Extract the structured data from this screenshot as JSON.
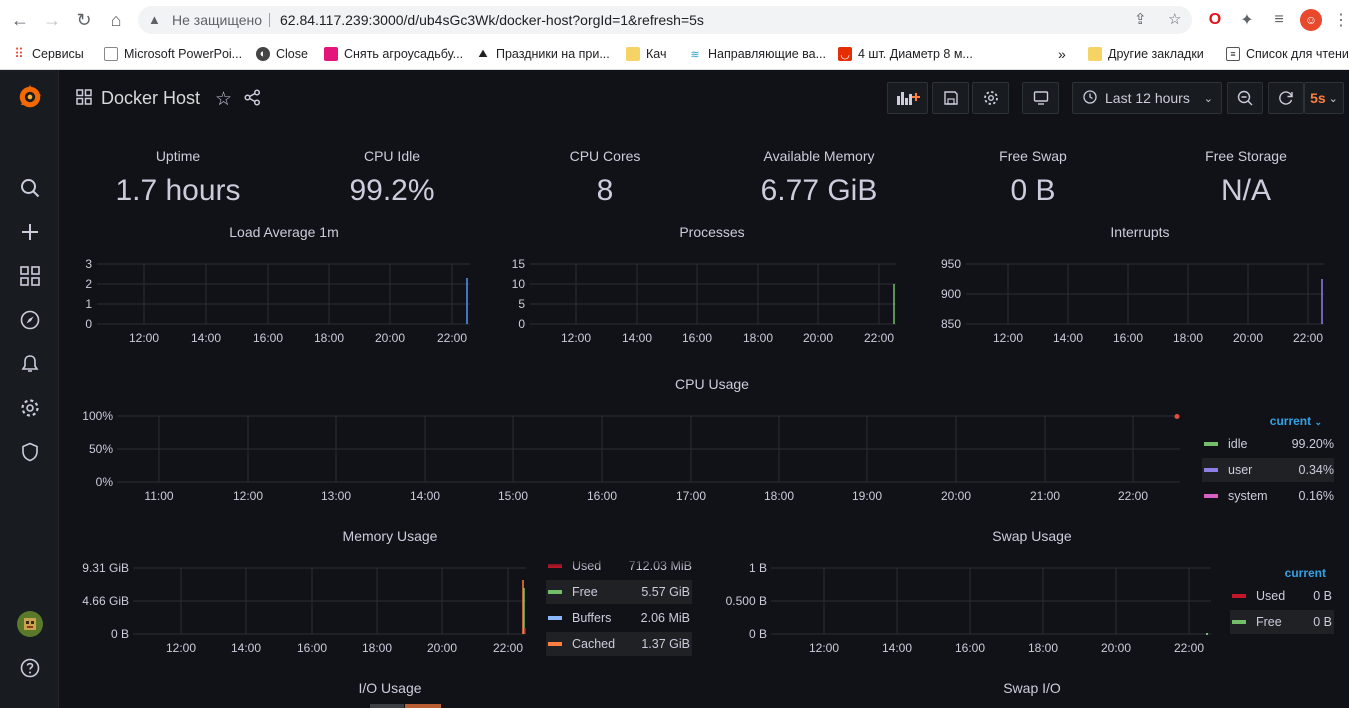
{
  "browser": {
    "address_warning": "Не защищено",
    "url": "62.84.117.239:3000/d/ub4sGc3Wk/docker-host?orgId=1&refresh=5s",
    "bookmarks": [
      {
        "label": "Сервисы",
        "icon": "apps-grid-icon"
      },
      {
        "label": "Microsoft PowerPoi...",
        "icon": "document-icon"
      },
      {
        "label": "Close",
        "icon": "globe-icon"
      },
      {
        "label": "Снять агроусадьбу...",
        "icon": "pink-site-icon"
      },
      {
        "label": "Праздники на при...",
        "icon": "mountain-icon"
      },
      {
        "label": "Кач",
        "icon": "folder-icon"
      },
      {
        "label": "Направляющие ва...",
        "icon": "wave-icon"
      },
      {
        "label": "4 шт. Диаметр 8 м...",
        "icon": "aliexpress-icon"
      }
    ],
    "more_bookmarks": "»",
    "other_bookmarks": "Другие закладки",
    "reading_list": "Список для чтения"
  },
  "dashboard": {
    "title": "Docker Host",
    "time_range": "Last 12 hours",
    "refresh": "5s"
  },
  "stats": [
    {
      "title": "Uptime",
      "value": "1.7 hours"
    },
    {
      "title": "CPU Idle",
      "value": "99.2%"
    },
    {
      "title": "CPU Cores",
      "value": "8"
    },
    {
      "title": "Available Memory",
      "value": "6.77 GiB"
    },
    {
      "title": "Free Swap",
      "value": "0 B"
    },
    {
      "title": "Free Storage",
      "value": "N/A"
    }
  ],
  "panels": {
    "load": {
      "title": "Load Average 1m"
    },
    "processes": {
      "title": "Processes"
    },
    "interrupts": {
      "title": "Interrupts"
    },
    "cpu": {
      "title": "CPU Usage",
      "legend_header": "current",
      "legend": [
        {
          "name": "idle",
          "value": "99.20%",
          "color": "#73bf69"
        },
        {
          "name": "user",
          "value": "0.34%",
          "color": "#8f7ee6"
        },
        {
          "name": "system",
          "value": "0.16%",
          "color": "#d85ec8"
        }
      ]
    },
    "memory": {
      "title": "Memory Usage",
      "legend": [
        {
          "name": "Used",
          "value": "712.03 MiB",
          "color": "#c4162a"
        },
        {
          "name": "Free",
          "value": "5.57 GiB",
          "color": "#73bf69"
        },
        {
          "name": "Buffers",
          "value": "2.06 MiB",
          "color": "#8ab8ff"
        },
        {
          "name": "Cached",
          "value": "1.37 GiB",
          "color": "#ff7f3f"
        }
      ]
    },
    "swap": {
      "title": "Swap Usage",
      "legend_header": "current",
      "legend": [
        {
          "name": "Used",
          "value": "0 B",
          "color": "#c4162a"
        },
        {
          "name": "Free",
          "value": "0 B",
          "color": "#73bf69"
        }
      ]
    },
    "io": {
      "title": "I/O Usage"
    },
    "swapio": {
      "title": "Swap I/O"
    }
  },
  "chart_data": [
    {
      "type": "line",
      "title": "Load Average 1m",
      "x": [
        "12:00",
        "14:00",
        "16:00",
        "18:00",
        "20:00",
        "22:00"
      ],
      "yticks": [
        "0",
        "1",
        "2",
        "3"
      ],
      "ylim": [
        0,
        3
      ],
      "series": [
        {
          "color": "#5794f2",
          "values_note_last": [
            0,
            2.3
          ]
        }
      ]
    },
    {
      "type": "line",
      "title": "Processes",
      "x": [
        "12:00",
        "14:00",
        "16:00",
        "18:00",
        "20:00",
        "22:00"
      ],
      "yticks": [
        "0",
        "5",
        "10",
        "15"
      ],
      "ylim": [
        0,
        15
      ],
      "series": [
        {
          "color": "#73bf69",
          "last": [
            0,
            10
          ]
        }
      ]
    },
    {
      "type": "line",
      "title": "Interrupts",
      "x": [
        "12:00",
        "14:00",
        "16:00",
        "18:00",
        "20:00",
        "22:00"
      ],
      "yticks": [
        "850",
        "900",
        "950"
      ],
      "ylim": [
        850,
        950
      ],
      "series": [
        {
          "color": "#8f7ee6",
          "last": [
            850,
            925
          ]
        }
      ]
    },
    {
      "type": "line",
      "title": "CPU Usage",
      "x": [
        "11:00",
        "12:00",
        "13:00",
        "14:00",
        "15:00",
        "16:00",
        "17:00",
        "18:00",
        "19:00",
        "20:00",
        "21:00",
        "22:00"
      ],
      "yticks": [
        "0%",
        "50%",
        "100%"
      ],
      "ylim": [
        0,
        100
      ],
      "series": [
        {
          "name": "idle",
          "value": 99.2
        },
        {
          "name": "user",
          "value": 0.34
        },
        {
          "name": "system",
          "value": 0.16
        }
      ]
    },
    {
      "type": "line",
      "title": "Memory Usage",
      "x": [
        "12:00",
        "14:00",
        "16:00",
        "18:00",
        "20:00",
        "22:00"
      ],
      "yticks": [
        "0 B",
        "4.66 GiB",
        "9.31 GiB"
      ],
      "ylim": [
        "0 B",
        "9.31 GiB"
      ]
    },
    {
      "type": "line",
      "title": "Swap Usage",
      "x": [
        "12:00",
        "14:00",
        "16:00",
        "18:00",
        "20:00",
        "22:00"
      ],
      "yticks": [
        "0 B",
        "0.500 B",
        "1 B"
      ],
      "ylim": [
        0,
        1
      ]
    }
  ]
}
